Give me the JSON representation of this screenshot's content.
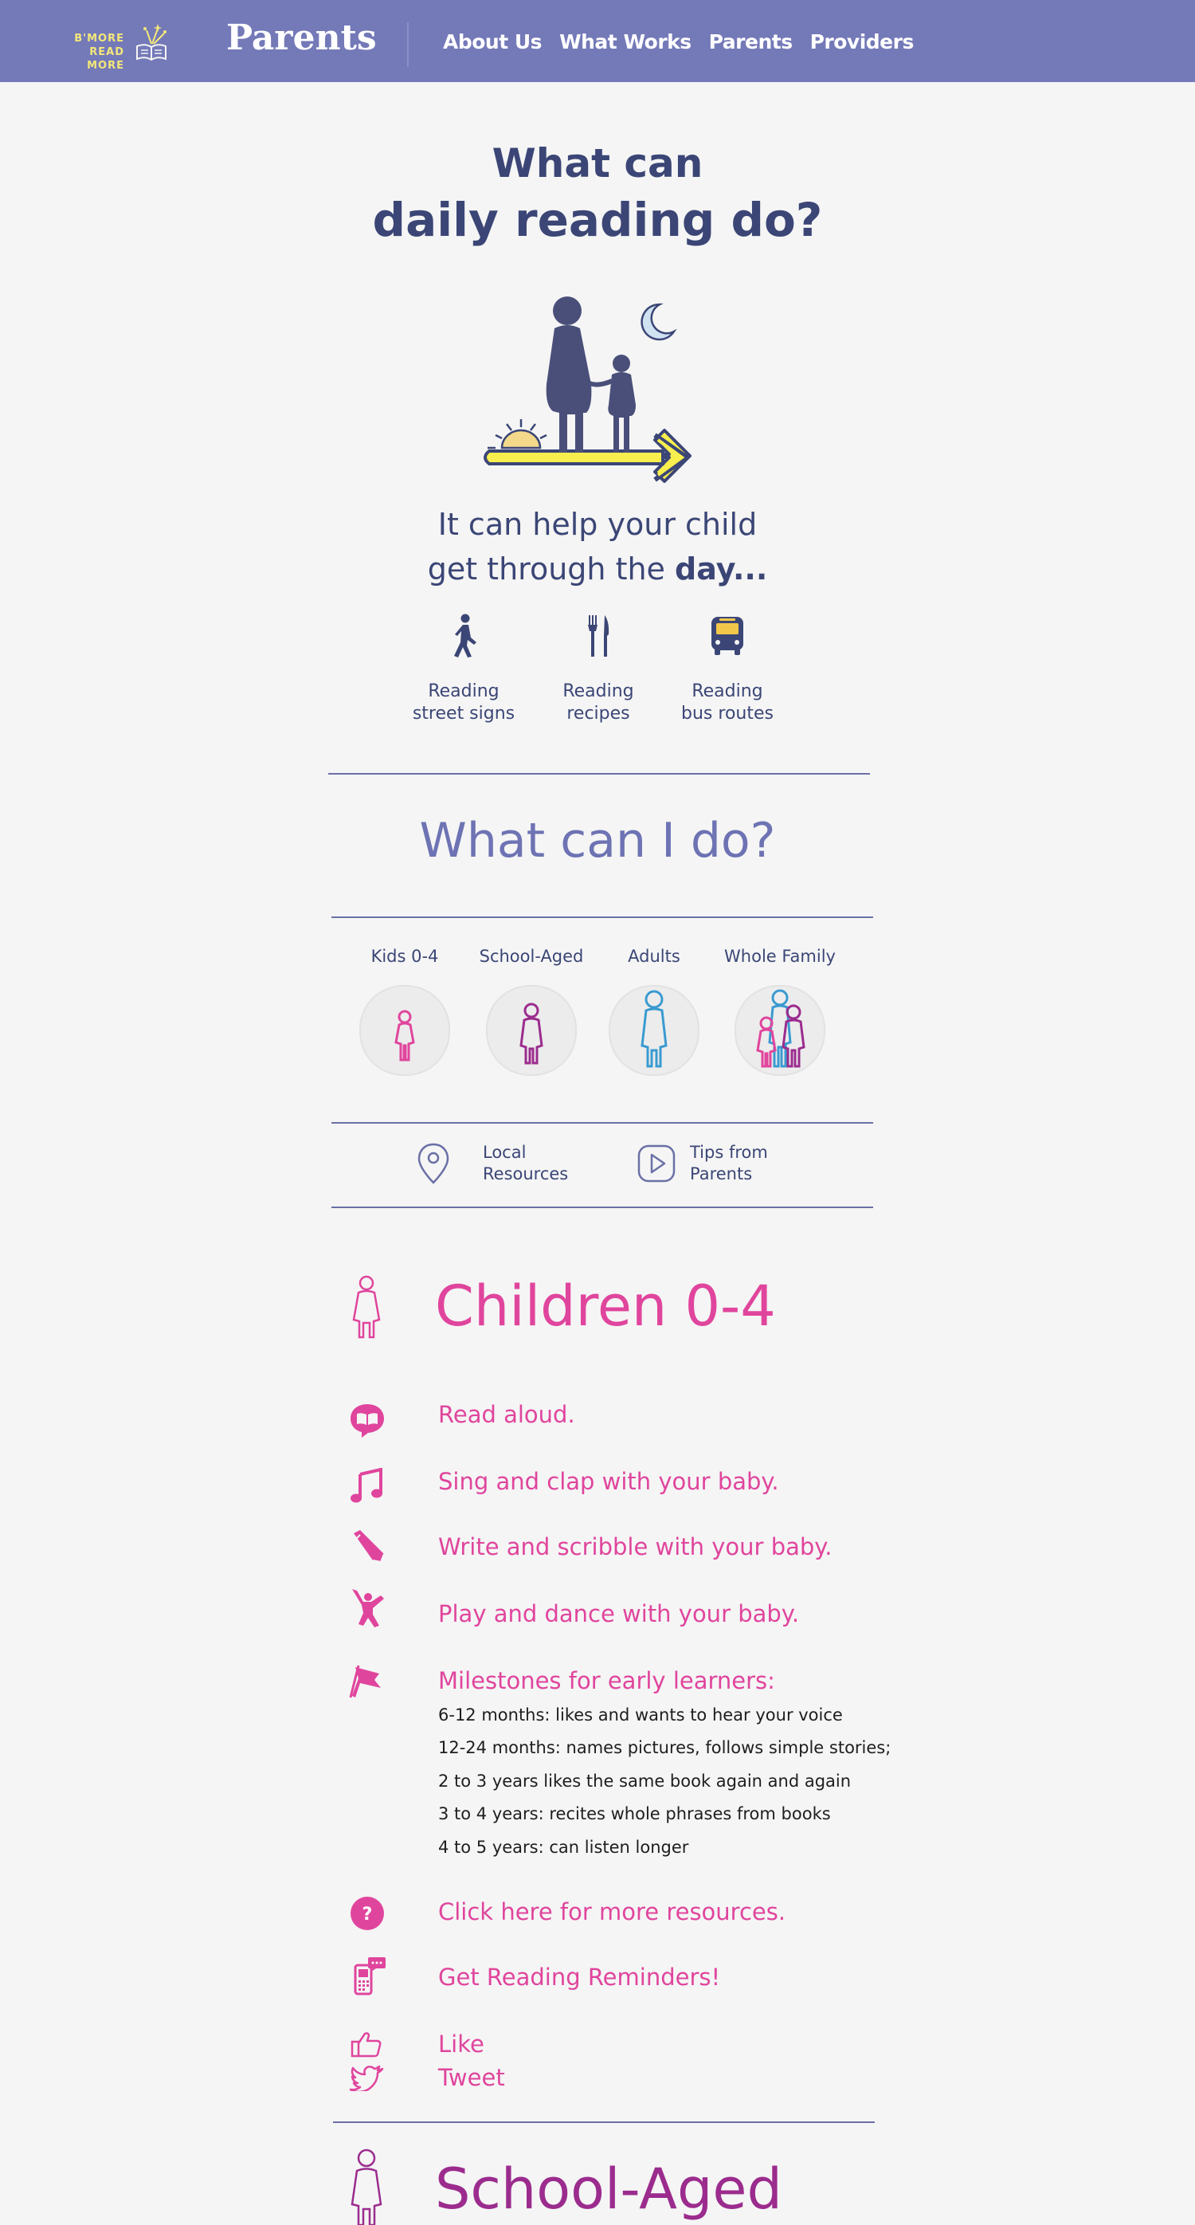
{
  "nav": {
    "logo_line1": "B'MORE",
    "logo_line2": "READ MORE",
    "title": "Parents",
    "links": [
      "About Us",
      "What Works",
      "Parents",
      "Providers"
    ]
  },
  "hero": {
    "line1": "What can",
    "line2": "daily reading do?",
    "sub1": "It can help your child",
    "sub2_prefix": "get through the",
    "sub2_bold": "day...",
    "items": [
      {
        "label1": "Reading",
        "label2": "street signs",
        "icon": "walking-person-icon"
      },
      {
        "label1": "Reading",
        "label2": "recipes",
        "icon": "fork-knife-icon"
      },
      {
        "label1": "Reading",
        "label2": "bus routes",
        "icon": "bus-icon"
      }
    ]
  },
  "what_can_i_do": {
    "title": "What can I do?",
    "audiences": [
      "Kids 0-4",
      "School-Aged",
      "Adults",
      "Whole Family"
    ],
    "resources": [
      {
        "line1": "Local",
        "line2": "Resources",
        "icon": "map-pin-icon"
      },
      {
        "line1": "Tips from",
        "line2": "Parents",
        "icon": "play-icon"
      }
    ]
  },
  "children": {
    "title": "Children 0-4",
    "activities": [
      {
        "text": "Read aloud.",
        "icon": "book-bubble-icon"
      },
      {
        "text": "Sing and clap with your baby.",
        "icon": "music-note-icon"
      },
      {
        "text": "Write and scribble with your baby.",
        "icon": "pencil-icon"
      },
      {
        "text": "Play and dance with your baby.",
        "icon": "dancing-child-icon"
      },
      {
        "text": "Milestones for early learners:",
        "icon": "flag-icon"
      }
    ],
    "milestones": [
      "6-12 months: likes and wants to hear your voice",
      "12-24 months: names pictures, follows simple stories;",
      "2 to 3 years likes the same book again and again",
      "3 to 4 years: recites whole phrases from books",
      "4 to 5 years: can listen longer"
    ],
    "more_resources": "Click here for more resources.",
    "reminders": "Get Reading Reminders!",
    "like": "Like",
    "tweet": "Tweet"
  },
  "school_aged": {
    "title": "School-Aged"
  },
  "colors": {
    "nav_bg": "#7479b8",
    "navy": "#3b4676",
    "periwinkle": "#6d73b3",
    "pink": "#e0459d",
    "purple": "#9b2c8e",
    "blue": "#3a9ad1",
    "yellow": "#f3e77a"
  }
}
